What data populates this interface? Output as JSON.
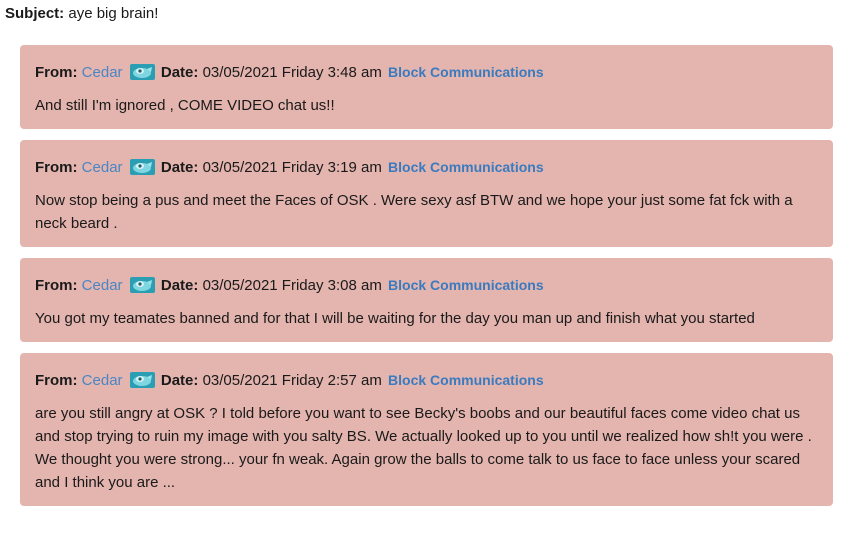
{
  "subject": {
    "label": "Subject:",
    "value": "aye big brain!"
  },
  "labels": {
    "from": "From:",
    "date": "Date:",
    "block": "Block Communications"
  },
  "messages": [
    {
      "from": "Cedar",
      "date": "03/05/2021 Friday 3:48 am",
      "body": "And still I'm ignored  , COME VIDEO chat us!!"
    },
    {
      "from": "Cedar",
      "date": "03/05/2021 Friday 3:19 am",
      "body": "Now stop being a pus and meet the Faces of OSK . Were sexy asf BTW and we hope  your just some  fat fck with a neck beard ."
    },
    {
      "from": "Cedar",
      "date": "03/05/2021 Friday 3:08 am",
      "body": "You got my teamates  banned and for that I will be waiting for the day you man up and finish what you started"
    },
    {
      "from": "Cedar",
      "date": "03/05/2021 Friday 2:57 am",
      "body": "are you still angry at OSK ? I told before you want to see Becky's boobs and our beautiful  faces come video chat us and stop trying to ruin my image with you salty BS. We actually  looked up to you until we realized how sh!t you were . We thought you were strong... your fn weak. Again grow the balls to come talk to us face to face unless your scared and I think you are ..."
    }
  ],
  "colors": {
    "card_bg": "#e4b4ae",
    "link": "#4a86c5",
    "avatar_bg": "#2a9fb3"
  },
  "icons": {
    "avatar": "sender-avatar-icon"
  }
}
